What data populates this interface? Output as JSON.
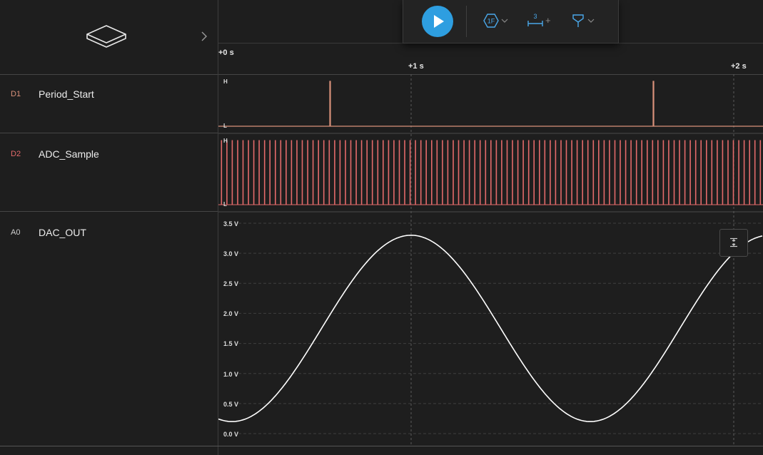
{
  "timeline": {
    "ticks": [
      {
        "label": "+0 s",
        "t": 0
      },
      {
        "label": "+1 s",
        "t": 1
      },
      {
        "label": "+2 s",
        "t": 2
      }
    ]
  },
  "channels": [
    {
      "id": "D1",
      "name": "Period_Start",
      "type": "digital",
      "color": "#d9917a",
      "high_label": "H",
      "low_label": "L"
    },
    {
      "id": "D2",
      "name": "ADC_Sample",
      "type": "digital",
      "color": "#e36a6a",
      "high_label": "H",
      "low_label": "L"
    },
    {
      "id": "A0",
      "name": "DAC_OUT",
      "type": "analog",
      "color": "#ffffff",
      "y_ticks": [
        "3.5 V",
        "3.0 V",
        "2.5 V",
        "2.0 V",
        "1.5 V",
        "1.0 V",
        "0.5 V",
        "0.0 V"
      ]
    }
  ],
  "toolbar": {
    "play_icon": "play-icon",
    "trigger_icon": "trigger-hexagon-icon",
    "trigger_label": "1F",
    "measure_icon": "measure-bracket-icon",
    "measure_count": "3",
    "measure_add": "+",
    "marker_icon": "marker-flag-icon",
    "accent": "#2e9ee0"
  },
  "device": {
    "icon": "device-icon",
    "expand_icon": "chevron-right-icon"
  },
  "fit_button_icon": "fit-vertical-icon"
}
